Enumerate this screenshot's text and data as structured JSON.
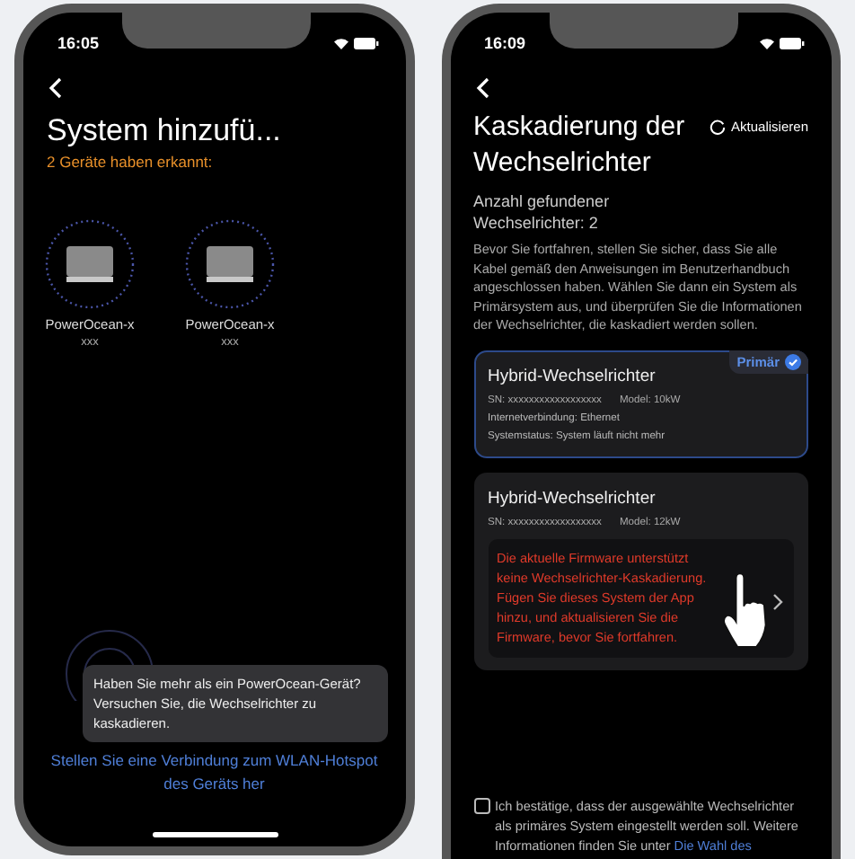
{
  "left_screen": {
    "status_bar": {
      "time": "16:05"
    },
    "title": "System hinzufü...",
    "subtitle": "2 Geräte haben erkannt:",
    "devices": [
      {
        "name": "PowerOcean-x",
        "serial": "xxx"
      },
      {
        "name": "PowerOcean-x",
        "serial": "xxx"
      }
    ],
    "tooltip": "Haben Sie mehr als ein PowerOcean-Gerät? Versuchen Sie, die Wechselrichter zu kaskadieren.",
    "hotspot_link": "Stellen Sie eine Verbindung zum WLAN-Hotspot des Geräts her"
  },
  "right_screen": {
    "status_bar": {
      "time": "16:09"
    },
    "title": "Kaskadierung der Wechselrichter",
    "refresh_button": "Aktualisieren",
    "count": "Anzahl gefundener Wechselrichter: 2",
    "description": "Bevor Sie fortfahren, stellen Sie sicher, dass Sie alle Kabel gemäß den Anweisungen im Benutzerhandbuch angeschlossen haben. Wählen Sie dann ein System als Primärsystem aus, und überprüfen Sie die Informationen der Wechselrichter, die kaskadiert werden sollen.",
    "inverters": [
      {
        "name": "Hybrid-Wechselrichter",
        "selected": true,
        "badge": "Primär",
        "sn": "SN: xxxxxxxxxxxxxxxxxx",
        "model": "Model: 10kW",
        "details": [
          "Internetverbindung: Ethernet",
          "Systemstatus: System läuft nicht mehr"
        ]
      },
      {
        "name": "Hybrid-Wechselrichter",
        "selected": false,
        "sn": "SN: xxxxxxxxxxxxxxxxxx",
        "model": "Model: 12kW",
        "warning": "Die aktuelle Firmware unterstützt keine Wechselrichter-Kaskadierung. Fügen Sie dieses System der App hinzu, und aktualisieren Sie die Firmware, bevor Sie fortfahren."
      }
    ],
    "confirm": {
      "checked": false,
      "text": "Ich bestätige, dass der ausgewählte Wechselrichter als primäres System eingestellt werden soll. Weitere Informationen finden Sie unter ",
      "link": "Die Wahl des"
    }
  }
}
